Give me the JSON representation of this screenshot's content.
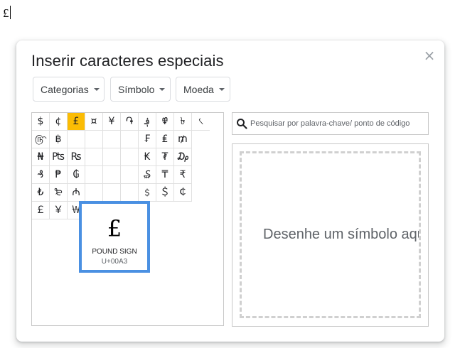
{
  "document": {
    "text": "£"
  },
  "dialog": {
    "title": "Inserir caracteres especiais",
    "close_glyph": "×",
    "dropdowns": [
      {
        "label": "Categorias"
      },
      {
        "label": "Símbolo"
      },
      {
        "label": "Moeda"
      }
    ],
    "grid": {
      "rows": [
        [
          "$",
          "¢",
          "£",
          "¤",
          "¥",
          "֏",
          "؋",
          "߾",
          "৳",
          "৻"
        ],
        [
          "௹",
          "฿",
          "",
          "",
          "",
          "",
          "₣",
          "₤",
          "₥"
        ],
        [
          "₦",
          "₧",
          "₨",
          "",
          "",
          "",
          "₭",
          "₮",
          "₯"
        ],
        [
          "₰",
          "₱",
          "₲",
          "",
          "",
          "",
          "₷",
          "₸",
          "₹"
        ],
        [
          "₺",
          "₻",
          "₼",
          "",
          "",
          "",
          "﹩",
          "＄",
          "￠"
        ],
        [
          "￡",
          "￥",
          "￦"
        ]
      ],
      "selected": "£"
    },
    "tooltip": {
      "glyph": "£",
      "name": "POUND SIGN",
      "code": "U+00A3"
    },
    "search": {
      "placeholder": "Pesquisar por palavra-chave/ ponto de código",
      "icon": "search-icon"
    },
    "draw": {
      "hint": "Desenhe um símbolo aqui"
    }
  }
}
